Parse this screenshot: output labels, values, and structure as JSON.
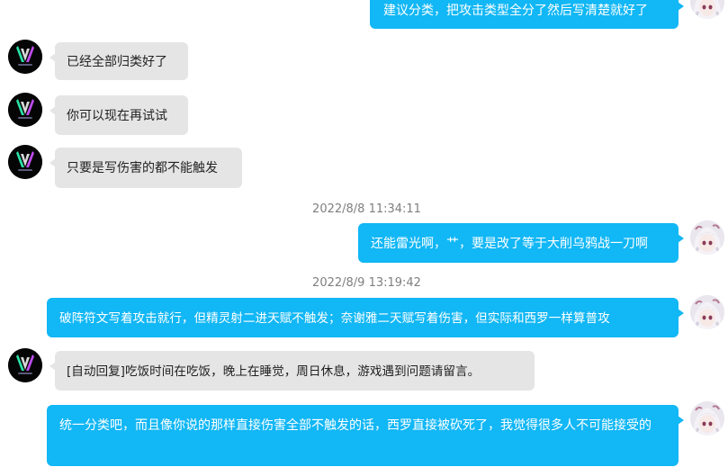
{
  "messages": [
    {
      "text": "建议分类，把攻击类型全分了然后写清楚就好了"
    },
    {
      "text": "已经全部归类好了"
    },
    {
      "text": "你可以现在再试试"
    },
    {
      "text": "只要是写伤害的都不能触发"
    },
    {
      "text": "还能雷光啊，艹，要是改了等于大削乌鸦战一刀啊"
    },
    {
      "text": "破阵符文写着攻击就行，但精灵射二进天赋不触发；奈谢雅二天赋写着伤害，但实际和西罗一样算普攻"
    },
    {
      "text": "[自动回复]吃饭时间在吃饭，晚上在睡觉，周日休息，游戏遇到问题请留言。"
    },
    {
      "text": "统一分类吧，而且像你说的那样直接伤害全部不触发的话，西罗直接被砍死了，我觉得很多人不可能接受的"
    }
  ],
  "timestamps": [
    "2022/8/8 11:34:11",
    "2022/8/9 13:19:42"
  ],
  "avatars": {
    "bot": {
      "icon": "v-logo-avatar-icon",
      "bg": "#050505"
    },
    "user": {
      "icon": "anime-girl-avatar-icon"
    }
  },
  "colors": {
    "outgoing_bubble": "#12b7f5",
    "incoming_bubble": "#e5e5e5",
    "timestamp_text": "#7f7f7f"
  }
}
